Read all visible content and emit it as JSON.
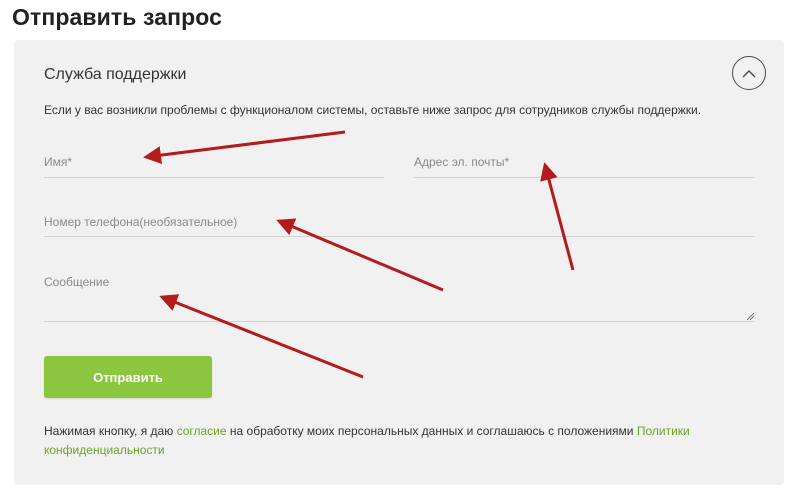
{
  "page_title": "Отправить запрос",
  "card": {
    "title": "Служба поддержки",
    "intro": "Если у вас возникли проблемы с функционалом системы, оставьте ниже запрос для сотрудников службы поддержки."
  },
  "form": {
    "name_placeholder": "Имя*",
    "email_placeholder": "Адрес эл. почты*",
    "phone_placeholder": "Номер телефона(необязательное)",
    "message_placeholder": "Сообщение",
    "submit_label": "Отправить"
  },
  "consent": {
    "text_before": "Нажимая кнопку, я даю ",
    "link_consent": "согласие",
    "text_middle": " на обработку моих персональных данных и соглашаюсь с положениями ",
    "link_policy": "Политики конфиденциальности"
  },
  "icons": {
    "collapse": "chevron-up-icon",
    "annotation_arrow": "red-arrow-icon"
  },
  "colors": {
    "accent_green": "#8cc63f",
    "link_green": "#6aa52a",
    "card_bg": "#f1f1f2",
    "arrow_red": "#b51b1b"
  }
}
